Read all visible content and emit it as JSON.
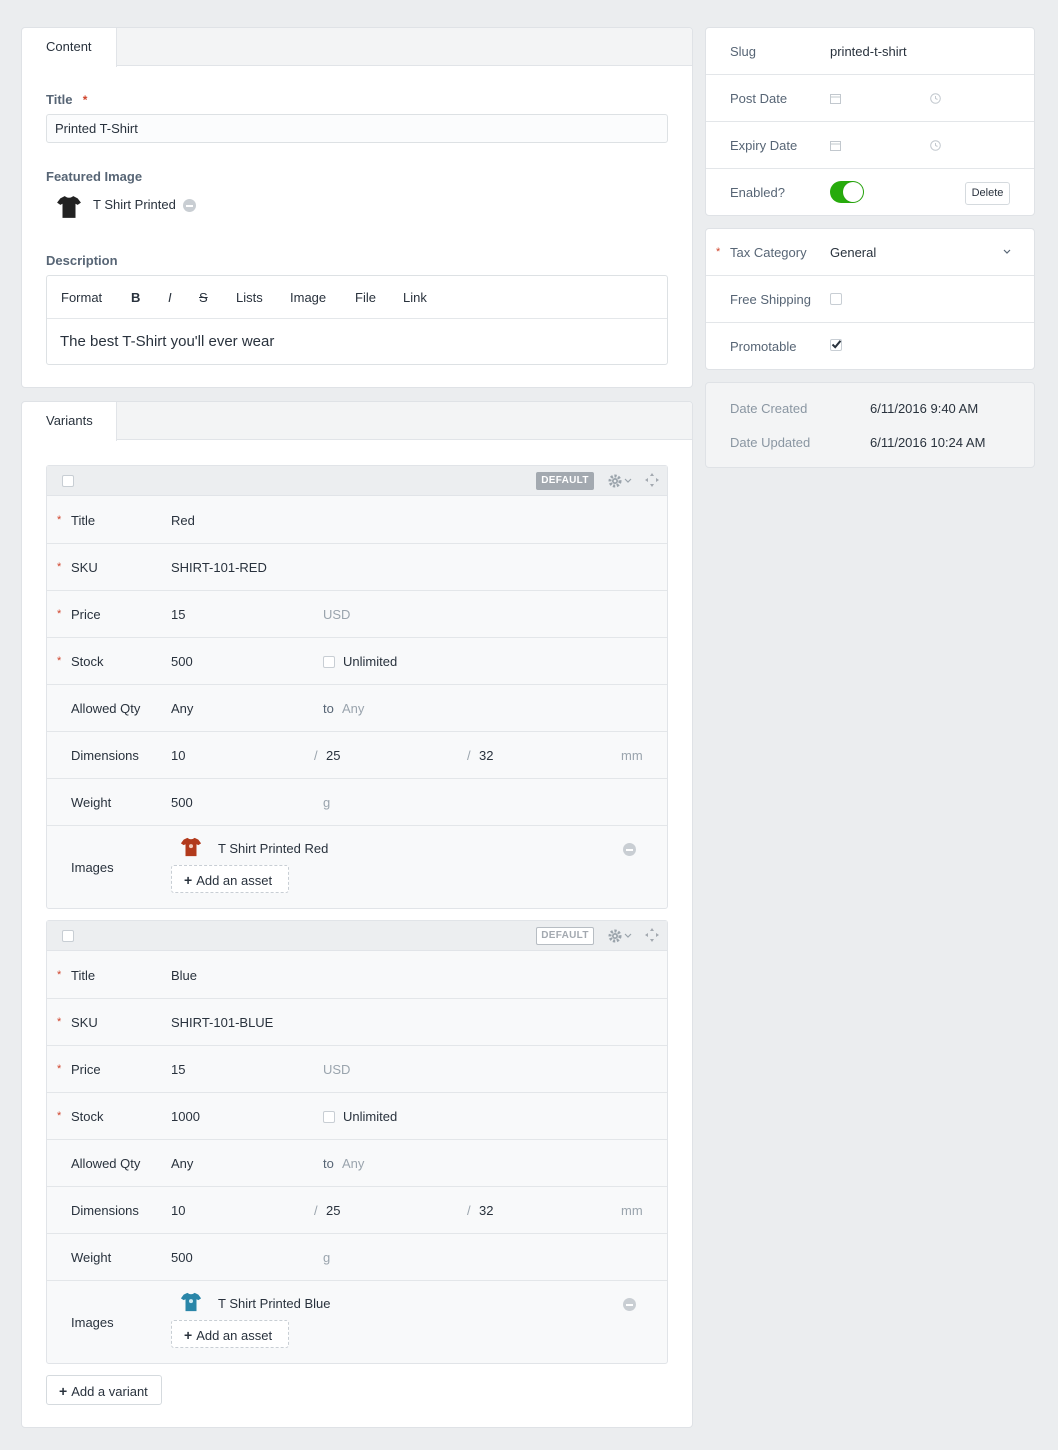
{
  "content_panel": {
    "tab": "Content",
    "title_label": "Title",
    "title_value": "Printed T-Shirt",
    "featured_image_label": "Featured Image",
    "featured_image_name": "T Shirt Printed",
    "description_label": "Description",
    "toolbar": {
      "format": "Format",
      "bold": "B",
      "italic": "I",
      "strike": "S",
      "lists": "Lists",
      "image": "Image",
      "file": "File",
      "link": "Link"
    },
    "description_text": "The best T-Shirt you'll ever wear"
  },
  "variants_panel": {
    "tab": "Variants",
    "labels": {
      "title": "Title",
      "sku": "SKU",
      "price": "Price",
      "stock": "Stock",
      "allowed_qty": "Allowed Qty",
      "dimensions": "Dimensions",
      "weight": "Weight",
      "images": "Images",
      "default_badge": "DEFAULT",
      "currency": "USD",
      "unlimited": "Unlimited",
      "any": "Any",
      "to": "to",
      "slash": "/",
      "dim_unit": "mm",
      "weight_unit": "g",
      "add_asset": "Add an asset"
    },
    "variants": [
      {
        "title": "Red",
        "sku": "SHIRT-101-RED",
        "price": "15",
        "stock": "500",
        "dim_l": "10",
        "dim_w": "25",
        "dim_h": "32",
        "weight": "500",
        "image_name": "T Shirt Printed Red",
        "image_color": "#b23a1c",
        "is_default": true
      },
      {
        "title": "Blue",
        "sku": "SHIRT-101-BLUE",
        "price": "15",
        "stock": "1000",
        "dim_l": "10",
        "dim_w": "25",
        "dim_h": "32",
        "weight": "500",
        "image_name": "T Shirt Printed Blue",
        "image_color": "#2a86a8",
        "is_default": false
      }
    ],
    "add_variant": "Add a variant"
  },
  "settings_panel": {
    "slug_label": "Slug",
    "slug_value": "printed-t-shirt",
    "post_date_label": "Post Date",
    "expiry_date_label": "Expiry Date",
    "enabled_label": "Enabled?",
    "enabled": true,
    "delete_label": "Delete"
  },
  "tax_panel": {
    "tax_category_label": "Tax Category",
    "tax_category_value": "General",
    "free_shipping_label": "Free Shipping",
    "free_shipping": false,
    "promotable_label": "Promotable",
    "promotable": true
  },
  "meta_panel": {
    "date_created_label": "Date Created",
    "date_created": "6/11/2016 9:40 AM",
    "date_updated_label": "Date Updated",
    "date_updated": "6/11/2016 10:24 AM"
  },
  "colors": {
    "accent_toggle": "#27ab0c",
    "required": "#d0442b",
    "shirt_black": "#222222"
  }
}
